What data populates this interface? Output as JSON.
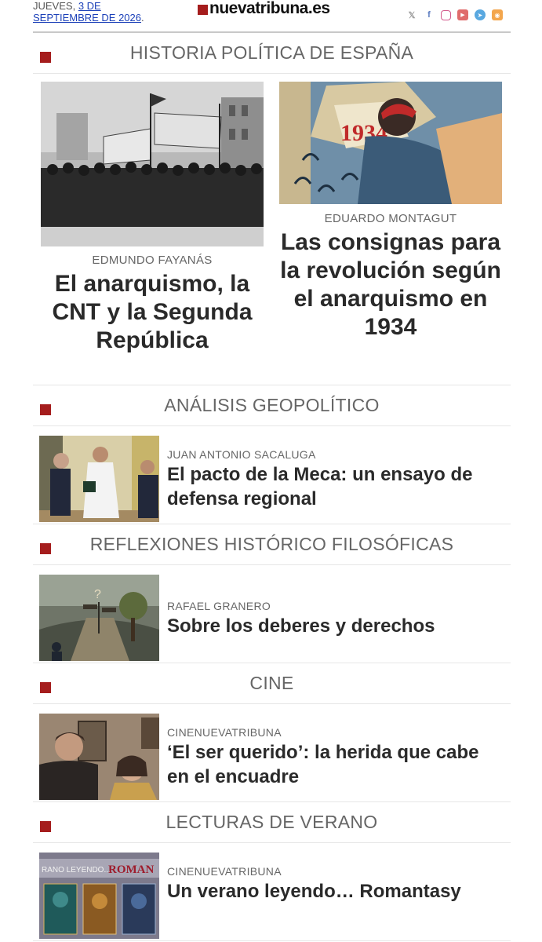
{
  "header": {
    "date_prefix": "JUEVES,",
    "date_link_line1": "3 DE",
    "date_link_line2": "SEPTIEMBRE DE 2026",
    "date_suffix": ".",
    "logo": "nuevatribuna.es",
    "social": [
      "x-icon",
      "facebook-icon",
      "instagram-icon",
      "youtube-icon",
      "telegram-icon",
      "rss-icon"
    ]
  },
  "sections": [
    {
      "title": "HISTORIA POLÍTICA DE ESPAÑA",
      "articles": [
        {
          "author": "EDMUNDO FAYANÁS",
          "headline": "El anarquismo, la CNT y la Segunda República",
          "image": "protest-crowd-photo"
        },
        {
          "author": "EDUARDO MONTAGUT",
          "headline": "Las consignas para la revolución según el anarquismo en 1934",
          "image": "poster-1934",
          "poster_text": "1934"
        }
      ]
    },
    {
      "title": "ANÁLISIS GEOPOLÍTICO",
      "articles": [
        {
          "author": "JUAN ANTONIO SACALUGA",
          "headline": "El pacto de la Meca: un ensayo de defensa regional",
          "image": "handshake-photo"
        }
      ]
    },
    {
      "title": "REFLEXIONES HISTÓRICO FILOSÓFICAS",
      "articles": [
        {
          "author": "RAFAEL GRANERO",
          "headline": "Sobre los deberes y derechos",
          "image": "crossroads-illustration"
        }
      ]
    },
    {
      "title": "CINE",
      "articles": [
        {
          "author": "CINENUEVATRIBUNA",
          "headline": "‘El ser querido’: la herida que cabe en el encuadre",
          "image": "film-still"
        }
      ]
    },
    {
      "title": "LECTURAS DE VERANO",
      "articles": [
        {
          "author": "CINENUEVATRIBUNA",
          "headline": "Un verano leyendo… Romantasy",
          "image": "book-covers",
          "banner_left": "RANO LEYENDO...",
          "banner_right": "ROMAN"
        }
      ]
    }
  ],
  "colors": {
    "accent": "#a51d1d",
    "link": "#1a3fb8"
  }
}
